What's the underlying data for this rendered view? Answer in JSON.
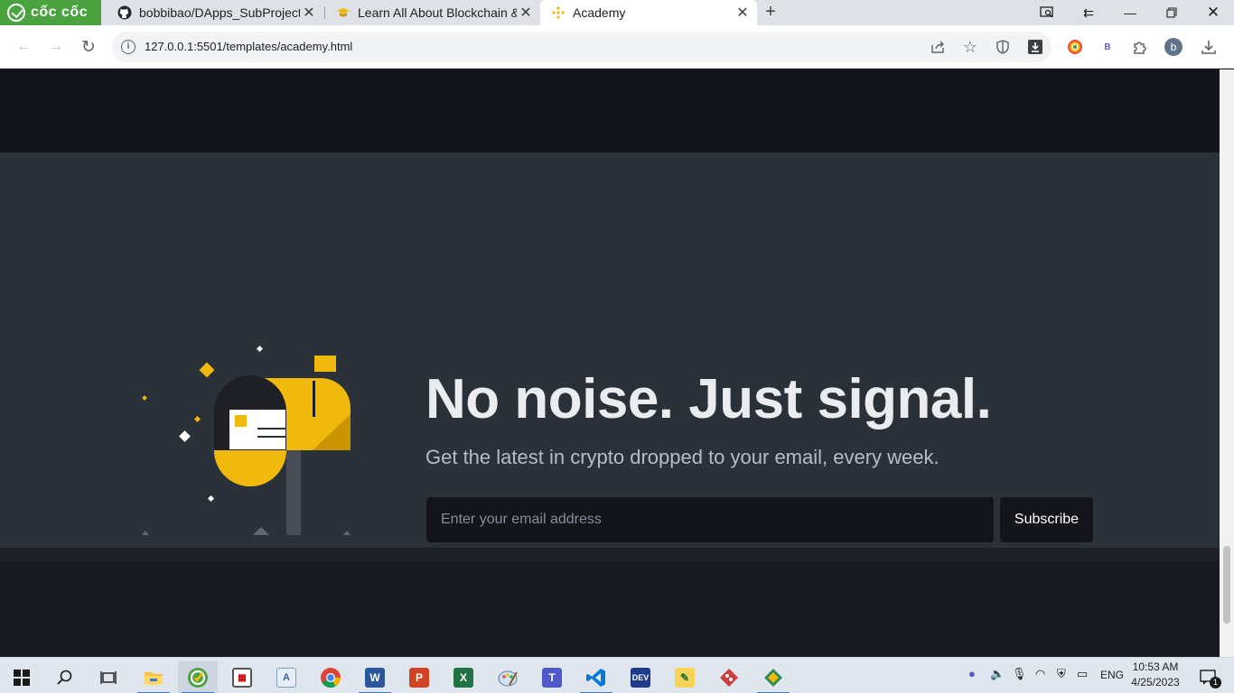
{
  "browser": {
    "logo_text": "cốc cốc",
    "tabs": [
      {
        "title": "bobbibao/DApps_SubProject",
        "icon": "github-icon",
        "active": false
      },
      {
        "title": "Learn All About Blockchain &",
        "icon": "graduation-cap-icon",
        "active": false
      },
      {
        "title": "Academy",
        "icon": "binance-icon",
        "active": true
      }
    ],
    "url": "127.0.0.1:5501/templates/academy.html",
    "profile_initial": "b",
    "extension_letter": "B"
  },
  "newsletter": {
    "headline": "No noise. Just signal.",
    "subheadline": "Get the latest in crypto dropped to your email, every week.",
    "email_placeholder": "Enter your email address",
    "subscribe_label": "Subscribe"
  },
  "taskbar": {
    "language": "ENG",
    "time": "10:53 AM",
    "date": "4/25/2023",
    "notification_count": "1",
    "apps": [
      "file-explorer",
      "coccoc-browser",
      "calendar-app",
      "text-editor-app",
      "chrome",
      "word",
      "powerpoint",
      "excel",
      "paint-app",
      "teams",
      "vscode",
      "dev-app",
      "sticky-notes-app",
      "git-app",
      "gitkraken-app"
    ]
  },
  "colors": {
    "brand_yellow": "#f0b90b",
    "section_bg": "#2b3139",
    "dark_bg": "#14151a",
    "headline": "#eaecef",
    "subhead": "#b7bdc6",
    "browser_green": "#4aa33f"
  }
}
